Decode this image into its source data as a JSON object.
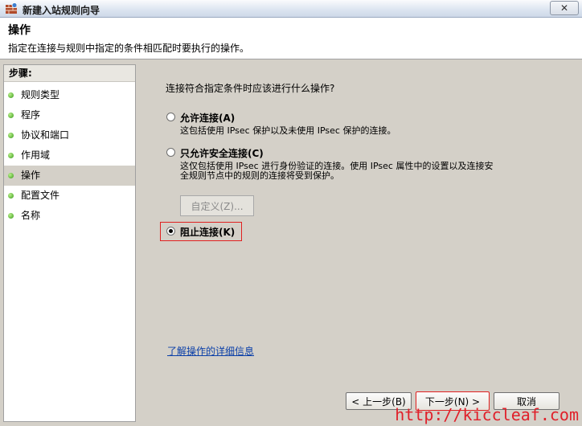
{
  "window": {
    "title": "新建入站规则向导",
    "close_label": "✕"
  },
  "header": {
    "title": "操作",
    "subtitle": "指定在连接与规则中指定的条件相匹配时要执行的操作。"
  },
  "sidebar": {
    "heading": "步骤:",
    "steps": [
      {
        "label": "规则类型"
      },
      {
        "label": "程序"
      },
      {
        "label": "协议和端口"
      },
      {
        "label": "作用域"
      },
      {
        "label": "操作"
      },
      {
        "label": "配置文件"
      },
      {
        "label": "名称"
      }
    ],
    "active_step": "操作"
  },
  "main": {
    "question": "连接符合指定条件时应该进行什么操作?",
    "options": [
      {
        "label": "允许连接(A)",
        "description": "这包括使用 IPsec 保护以及未使用 IPsec 保护的连接。",
        "selected": false
      },
      {
        "label": "只允许安全连接(C)",
        "description_lines": [
          "这仅包括使用 IPsec 进行身份验证的连接。使用 IPsec 属性中的设置以及连接安",
          "全规则节点中的规则的连接将受到保护。"
        ],
        "selected": false
      },
      {
        "label": "阻止连接(K)",
        "selected": true
      }
    ],
    "customize_label": "自定义(Z)...",
    "learn_more": "了解操作的详细信息"
  },
  "footer": {
    "back_label": "< 上一步(B)",
    "next_label": "下一步(N) >",
    "cancel_label": "取消"
  },
  "watermark": "http://kiccleaf.com",
  "colors": {
    "highlight": "#e02020",
    "link": "#0b3fa8",
    "step_bullet": "#3a9a1c"
  }
}
